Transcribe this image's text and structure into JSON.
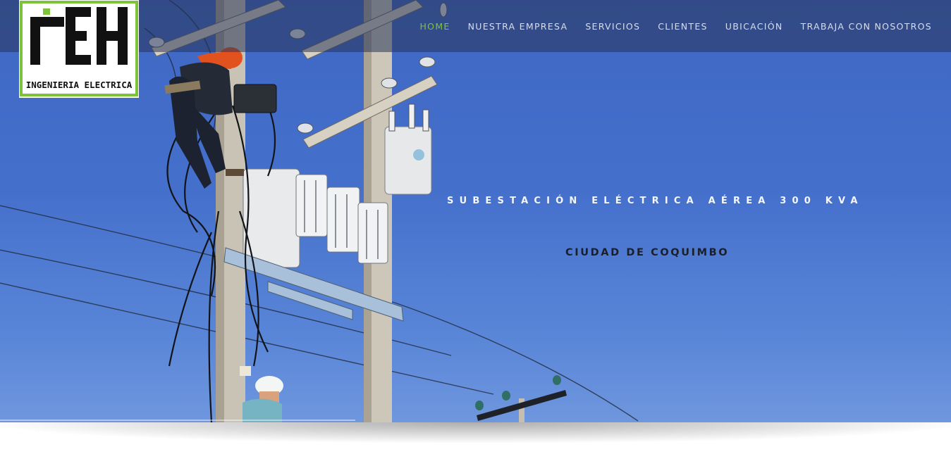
{
  "logo": {
    "mark": "iEH",
    "tagline": "INGENIERIA ELECTRICA",
    "accent_color": "#7cc33a"
  },
  "nav": {
    "items": [
      {
        "label": "HOME",
        "active": true
      },
      {
        "label": "NUESTRA EMPRESA",
        "active": false
      },
      {
        "label": "SERVICIOS",
        "active": false
      },
      {
        "label": "CLIENTES",
        "active": false
      },
      {
        "label": "UBICACIÓN",
        "active": false
      },
      {
        "label": "TRABAJA CON NOSOTROS",
        "active": false
      }
    ],
    "active_color": "#7cc33a"
  },
  "hero": {
    "headline": "SUBESTACIÓN ELÉCTRICA AÉREA 300 KVA",
    "subheadline": "CIUDAD DE COQUIMBO",
    "image_subject": "utility-pole-transformer-workers"
  }
}
